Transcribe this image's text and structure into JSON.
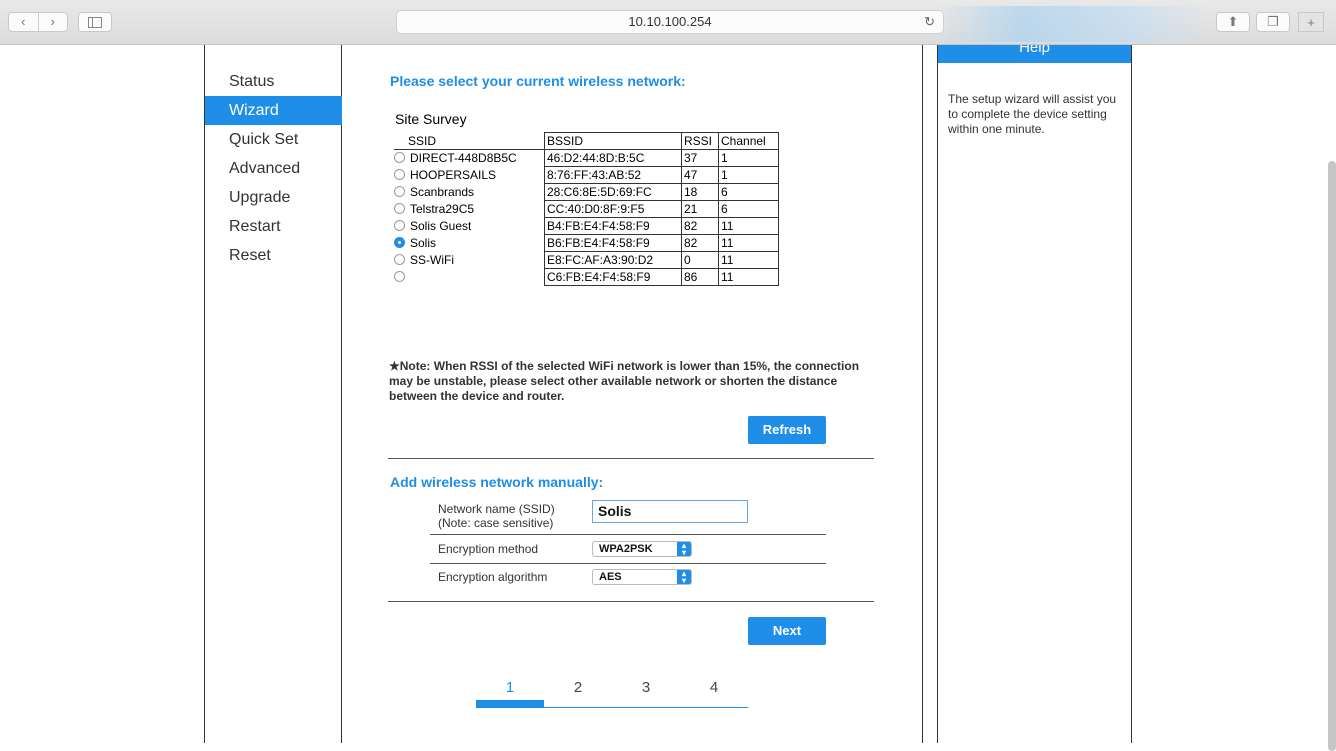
{
  "browser": {
    "url": "10.10.100.254",
    "back_icon": "chevron-left-icon",
    "forward_icon": "chevron-right-icon",
    "reload_icon": "reload-icon",
    "new_tab_label": "+"
  },
  "nav": {
    "items": [
      "Status",
      "Wizard",
      "Quick Set",
      "Advanced",
      "Upgrade",
      "Restart",
      "Reset"
    ],
    "active": "Wizard"
  },
  "main": {
    "heading": "Please select your current wireless network:",
    "survey_label": "Site Survey",
    "columns": [
      "SSID",
      "BSSID",
      "RSSI",
      "Channel"
    ],
    "networks": [
      {
        "ssid": "DIRECT-448D8B5C",
        "bssid": "46:D2:44:8D:B:5C",
        "rssi": "37",
        "channel": "1",
        "selected": false
      },
      {
        "ssid": "HOOPERSAILS",
        "bssid": "8:76:FF:43:AB:52",
        "rssi": "47",
        "channel": "1",
        "selected": false
      },
      {
        "ssid": "Scanbrands",
        "bssid": "28:C6:8E:5D:69:FC",
        "rssi": "18",
        "channel": "6",
        "selected": false
      },
      {
        "ssid": "Telstra29C5",
        "bssid": "CC:40:D0:8F:9:F5",
        "rssi": "21",
        "channel": "6",
        "selected": false
      },
      {
        "ssid": "Solis Guest",
        "bssid": "B4:FB:E4:F4:58:F9",
        "rssi": "82",
        "channel": "11",
        "selected": false
      },
      {
        "ssid": "Solis",
        "bssid": "B6:FB:E4:F4:58:F9",
        "rssi": "82",
        "channel": "11",
        "selected": true
      },
      {
        "ssid": "SS-WiFi",
        "bssid": "E8:FC:AF:A3:90:D2",
        "rssi": "0",
        "channel": "11",
        "selected": false
      },
      {
        "ssid": "",
        "bssid": "C6:FB:E4:F4:58:F9",
        "rssi": "86",
        "channel": "11",
        "selected": false
      }
    ],
    "note": "★Note: When RSSI of the selected WiFi network is lower than 15%, the connection may be unstable, please select other available network or shorten the distance between the device and router.",
    "refresh_label": "Refresh",
    "manual_heading": "Add wireless network manually:",
    "ssid_label_line1": "Network name (SSID)",
    "ssid_label_line2": "(Note: case sensitive)",
    "ssid_value": "Solis",
    "enc_method_label": "Encryption method",
    "enc_method_value": "WPA2PSK",
    "enc_algo_label": "Encryption algorithm",
    "enc_algo_value": "AES",
    "next_label": "Next",
    "steps": [
      "1",
      "2",
      "3",
      "4"
    ],
    "current_step": 1
  },
  "help": {
    "title": "Help",
    "text": "The setup wizard will assist you to complete the device setting within one minute."
  },
  "colors": {
    "accent": "#1e8ee8"
  }
}
